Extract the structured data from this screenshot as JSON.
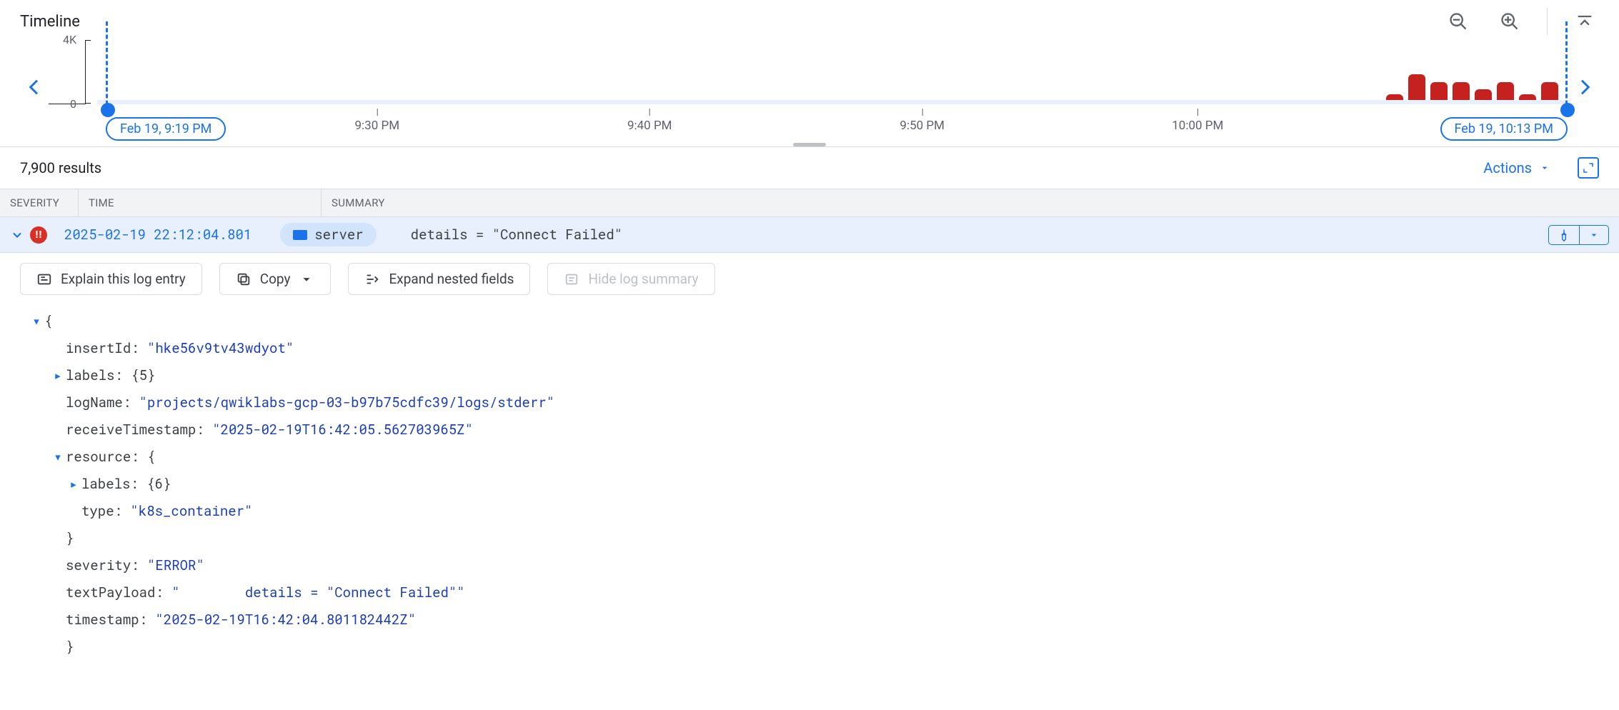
{
  "timeline": {
    "title": "Timeline",
    "y_max_label": "4K",
    "y_min_label": "0",
    "start_label": "Feb 19, 9:19 PM",
    "end_label": "Feb 19, 10:13 PM",
    "xticks": [
      "9:30 PM",
      "9:40 PM",
      "9:50 PM",
      "10:00 PM"
    ],
    "xtick_positions_pct": [
      19,
      37.5,
      56,
      74.7
    ]
  },
  "chart_data": {
    "type": "bar",
    "title": "Timeline",
    "xlabel": "",
    "ylabel": "",
    "ylim": [
      0,
      4000
    ],
    "x_range": [
      "Feb 19 9:19 PM",
      "Feb 19 10:13 PM"
    ],
    "categories": [
      "10:06 PM",
      "10:07 PM",
      "10:08 PM",
      "10:09 PM",
      "10:10 PM",
      "10:11 PM",
      "10:12 PM",
      "10:13 PM"
    ],
    "values": [
      400,
      1700,
      1200,
      1200,
      700,
      1200,
      400,
      1200
    ],
    "note": "Values estimated from bar heights relative to 4K axis; all activity clustered near end of range"
  },
  "results": {
    "count_text": "7,900 results",
    "actions_label": "Actions"
  },
  "columns": {
    "severity": "SEVERITY",
    "time": "TIME",
    "summary": "SUMMARY"
  },
  "log_row": {
    "severity_glyph": "!!",
    "timestamp": "2025-02-19 22:12:04.801",
    "chip_label": "server",
    "summary": "details = \"Connect Failed\""
  },
  "buttons": {
    "explain": "Explain this log entry",
    "copy": "Copy",
    "expand_nested": "Expand nested fields",
    "hide_summary": "Hide log summary"
  },
  "log_json": {
    "insertId": "\"hke56v9tv43wdyot\"",
    "labels_summary": "{5}",
    "logName": "\"projects/qwiklabs-gcp-03-b97b75cdfc39/logs/stderr\"",
    "receiveTimestamp": "\"2025-02-19T16:42:05.562703965Z\"",
    "resource_open": "{",
    "resource_labels_summary": "{6}",
    "resource_type": "\"k8s_container\"",
    "severity": "\"ERROR\"",
    "textPayload": "\"        details = \"Connect Failed\"\"",
    "timestamp": "\"2025-02-19T16:42:04.801182442Z\""
  }
}
